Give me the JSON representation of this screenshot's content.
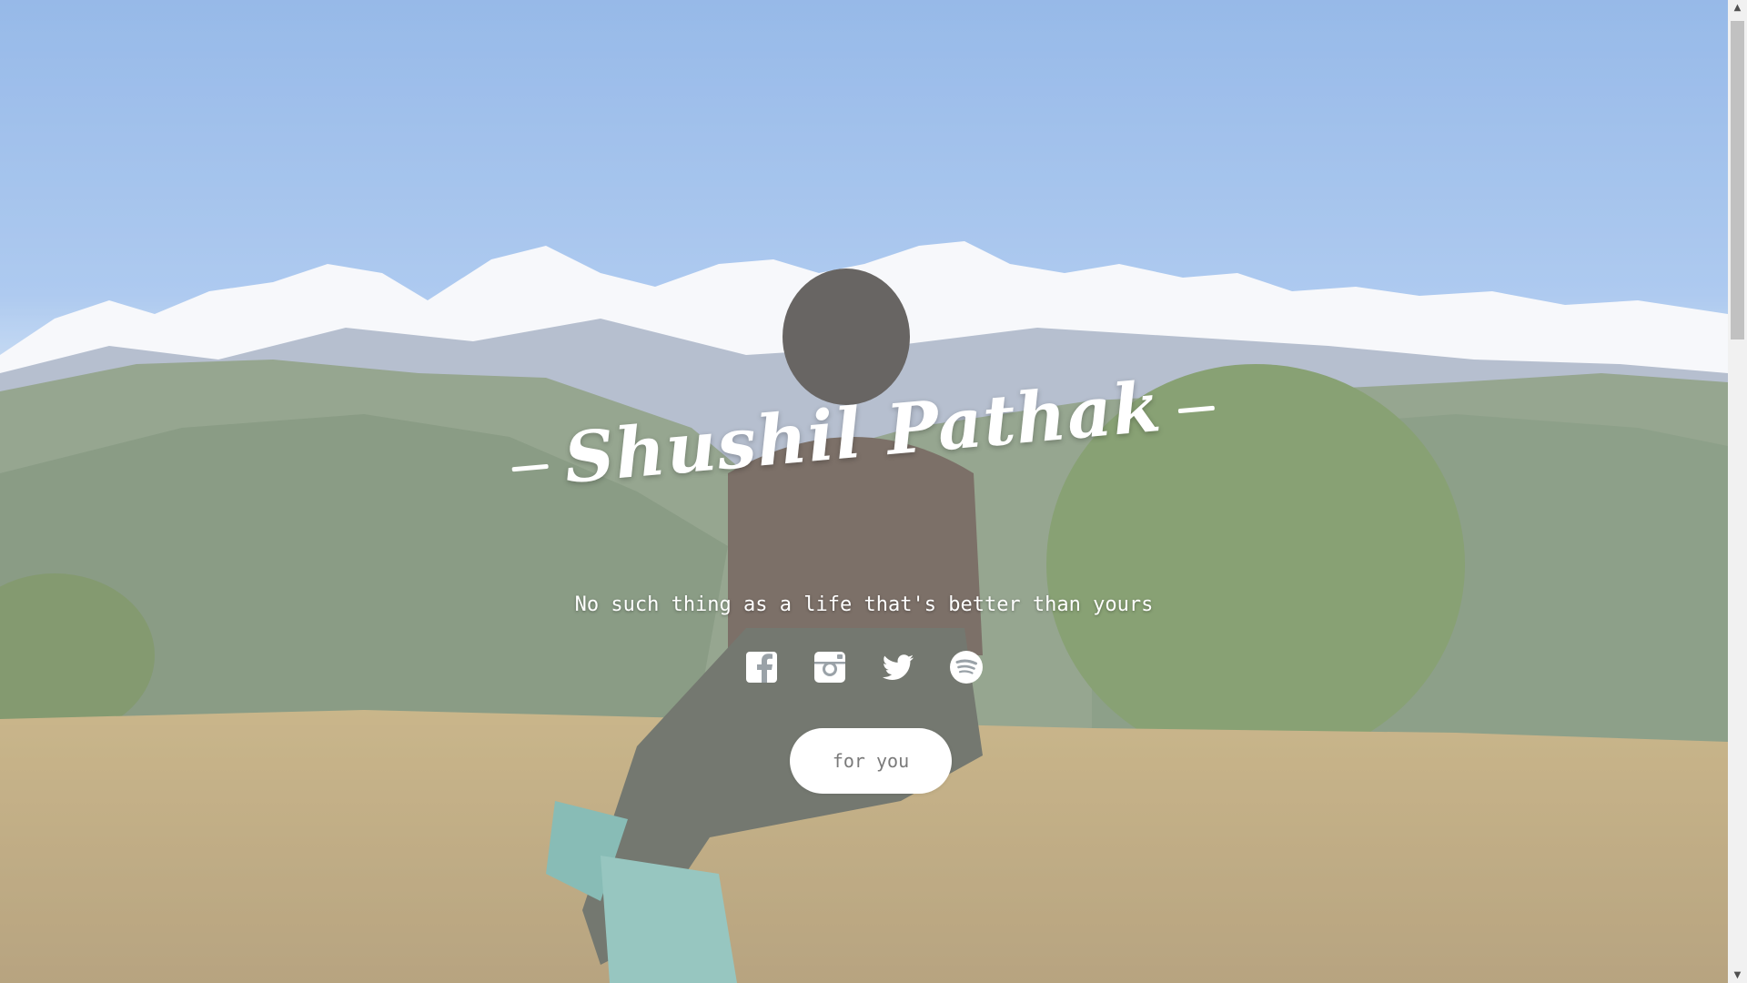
{
  "hero": {
    "title": "Shushil Pathak",
    "tagline": "No such thing as a life that's better than yours",
    "cta_label": "for you"
  },
  "socials": [
    {
      "icon": "facebook-icon"
    },
    {
      "icon": "instagram-icon"
    },
    {
      "icon": "twitter-icon"
    },
    {
      "icon": "spotify-icon"
    }
  ],
  "scrollbar": {
    "up_arrow": "▲",
    "down_arrow": "▼"
  },
  "colors": {
    "sky": "#7aa6e0",
    "text": "#ffffff",
    "button_bg": "#ffffff",
    "button_text": "#7a7a7a"
  }
}
